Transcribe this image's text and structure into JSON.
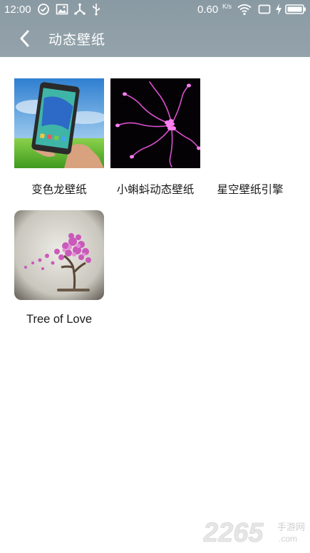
{
  "status_bar": {
    "time": "12:00",
    "speed": "0.60",
    "speed_unit": "K/s",
    "icons": [
      "check-circle-icon",
      "image-icon",
      "usb-share-icon",
      "usb-icon",
      "wifi-icon",
      "screen-icon",
      "charging-icon",
      "battery-icon"
    ]
  },
  "app_bar": {
    "title": "动态壁纸",
    "back_icon": "chevron-left-icon",
    "background": "#8f9fa7"
  },
  "wallpapers": [
    {
      "label": "变色龙壁纸"
    },
    {
      "label": "小蝌蚪动态壁纸"
    },
    {
      "label": "星空壁纸引擎"
    },
    {
      "label": "Tree of Love"
    }
  ],
  "watermark": {
    "number": "2265",
    "suffix_top": "手游网",
    "suffix_bottom": ".com"
  }
}
